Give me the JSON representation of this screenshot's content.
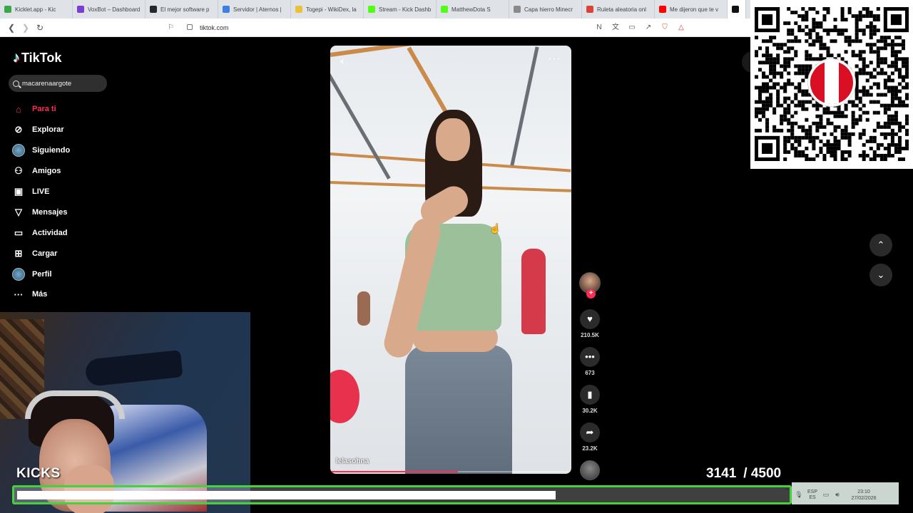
{
  "browser": {
    "tabs": [
      {
        "title": "Kicklet.app - Kic",
        "color": "#3aa84a"
      },
      {
        "title": "VoxBot – Dashboard",
        "color": "#7a3fd1"
      },
      {
        "title": "El mejor software p",
        "color": "#24292f"
      },
      {
        "title": "Servidor | Aternos |",
        "color": "#3f7fe0"
      },
      {
        "title": "Togepi - WikiDex, la",
        "color": "#e8c23a"
      },
      {
        "title": "Stream - Kick Dashb",
        "color": "#53fc18"
      },
      {
        "title": "MatthewDota S",
        "color": "#53fc18"
      },
      {
        "title": "Capa hierro Minecr",
        "color": "#8a8a8a"
      },
      {
        "title": "Ruleta aleatoria onl",
        "color": "#d9443a"
      },
      {
        "title": "Me dijeron que te v",
        "color": "#ff0000"
      }
    ],
    "url": "tiktok.com"
  },
  "tiktok": {
    "brand": "TikTok",
    "search_value": "macarenaargote",
    "menu": [
      {
        "label": "Para ti",
        "icon": "home-icon",
        "glyph": "⌂",
        "active": true
      },
      {
        "label": "Explorar",
        "icon": "compass-icon",
        "glyph": "⊘",
        "active": false
      },
      {
        "label": "Siguiendo",
        "icon": "following-avatar-icon",
        "glyph": "●",
        "active": false
      },
      {
        "label": "Amigos",
        "icon": "friends-icon",
        "glyph": "⚇",
        "active": false
      },
      {
        "label": "LIVE",
        "icon": "live-icon",
        "glyph": "▣",
        "active": false
      },
      {
        "label": "Mensajes",
        "icon": "messages-icon",
        "glyph": "▽",
        "active": false
      },
      {
        "label": "Actividad",
        "icon": "activity-icon",
        "glyph": "▭",
        "active": false
      },
      {
        "label": "Cargar",
        "icon": "upload-icon",
        "glyph": "⊞",
        "active": false
      },
      {
        "label": "Perfil",
        "icon": "profile-avatar-icon",
        "glyph": "●",
        "active": false
      },
      {
        "label": "Más",
        "icon": "more-icon",
        "glyph": "···",
        "active": false
      }
    ],
    "video": {
      "author": "lelasohna",
      "progress_fraction": 0.53
    },
    "actions": {
      "likes": "210.5K",
      "comments": "673",
      "saves": "30.2K",
      "shares": "23.2K"
    }
  },
  "overlay": {
    "streamer_label": "KICKS",
    "counter_current": "3141",
    "counter_goal": "/ 4500",
    "goal_fraction": 0.698,
    "flag_colors": [
      "#d91023",
      "#ffffff",
      "#d91023"
    ]
  },
  "taskbar": {
    "lang_top": "ESP",
    "lang_bottom": "ES",
    "time": "23:10",
    "date": "27/02/2026"
  },
  "colors": {
    "accent": "#fe2c55",
    "goal_border": "#45d13c"
  }
}
